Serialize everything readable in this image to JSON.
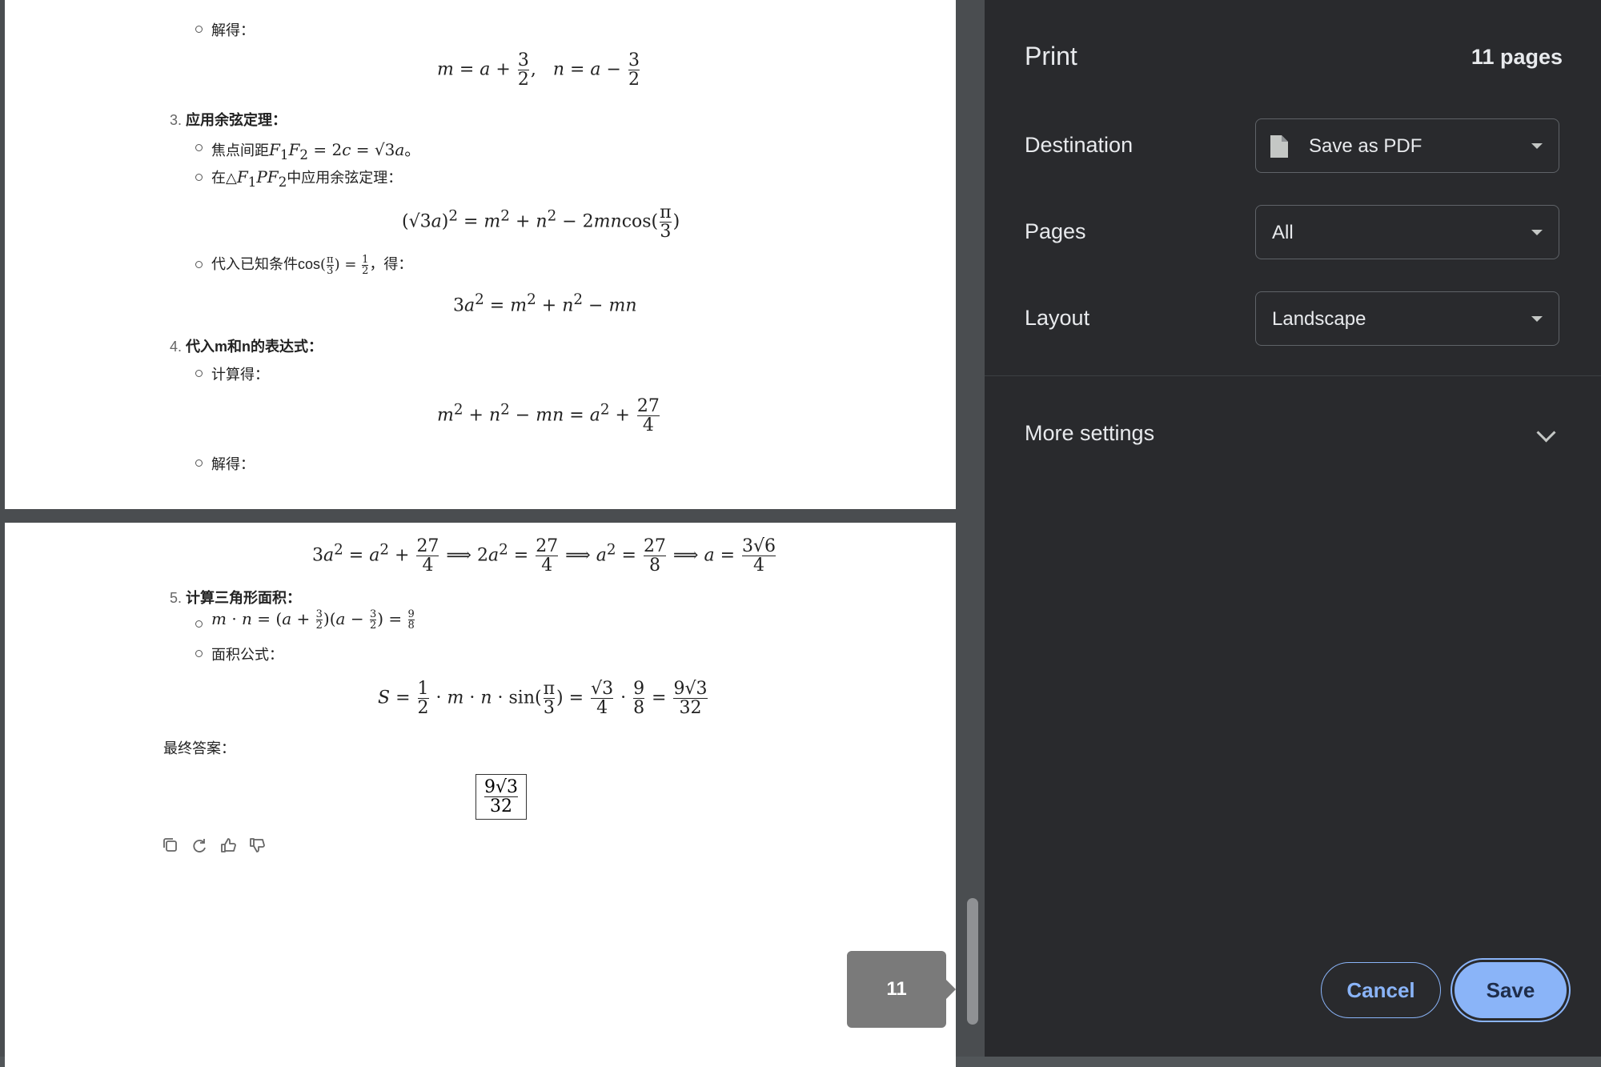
{
  "document": {
    "top_page": {
      "solve_label_1": "解得：",
      "step3_num": "3.",
      "step3_title": "应用余弦定理：",
      "focal_text": "焦点间距",
      "triangle_text": "在△",
      "triangle_text2": "中应用余弦定理：",
      "substitute_text": "代入已知条件cos",
      "substitute_text2": "，得：",
      "step4_num": "4.",
      "step4_title": "代入m和n的表达式：",
      "compute_label": "计算得：",
      "solve_label_2": "解得："
    },
    "bottom_page": {
      "step5_num": "5.",
      "step5_title": "计算三角形面积：",
      "area_formula_label": "面积公式：",
      "final_answer_label": "最终答案："
    }
  },
  "page_badge": "11",
  "print_panel": {
    "title": "Print",
    "page_count": "11 pages",
    "destination_label": "Destination",
    "destination_value": "Save as PDF",
    "pages_label": "Pages",
    "pages_value": "All",
    "layout_label": "Layout",
    "layout_value": "Landscape",
    "more_settings": "More settings",
    "cancel": "Cancel",
    "save": "Save"
  },
  "colors": {
    "panel_bg": "#292a2d",
    "accent": "#8ab4f8"
  },
  "icons": [
    "file-icon",
    "copy-icon",
    "refresh-icon",
    "thumbs-up-icon",
    "thumbs-down-icon",
    "chevron-down-icon"
  ]
}
